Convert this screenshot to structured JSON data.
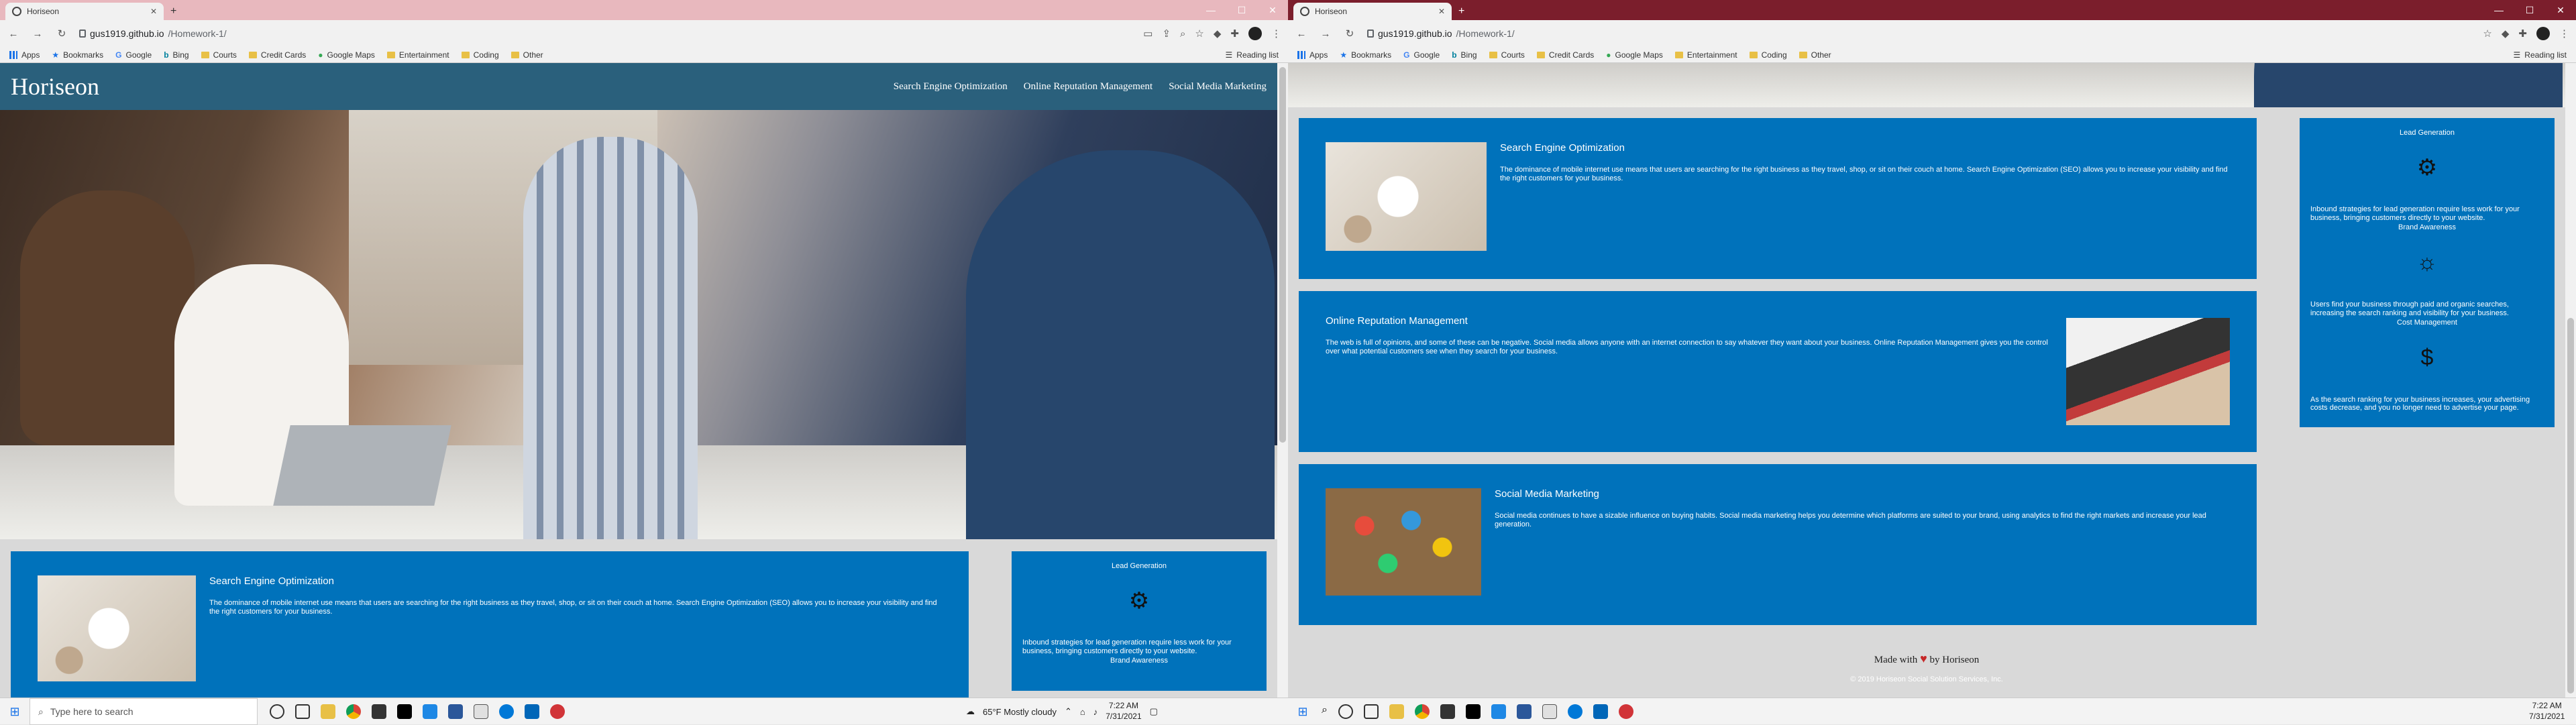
{
  "browser": {
    "tab_title": "Horiseon",
    "address_host": "gus1919.github.io",
    "address_path": "/Homework-1/",
    "bookmarks": [
      "Apps",
      "Bookmarks",
      "Google",
      "Bing",
      "Courts",
      "Credit Cards",
      "Google Maps",
      "Entertainment",
      "Coding",
      "Other"
    ],
    "reading_list": "Reading list"
  },
  "site": {
    "logo": "Horiseon",
    "nav": [
      "Search Engine Optimization",
      "Online Reputation Management",
      "Social Media Marketing"
    ],
    "cards": [
      {
        "title": "Search Engine Optimization",
        "text": "The dominance of mobile internet use means that users are searching for the right business as they travel, shop, or sit on their couch at home. Search Engine Optimization (SEO) allows you to increase your visibility and find the right customers for your business.",
        "image": "seo-image"
      },
      {
        "title": "Online Reputation Management",
        "text": "The web is full of opinions, and some of these can be negative. Social media allows anyone with an internet connection to say whatever they want about your business. Online Reputation Management gives you the control over what potential customers see when they search for your business.",
        "image": "orm-image"
      },
      {
        "title": "Social Media Marketing",
        "text": "Social media continues to have a sizable influence on buying habits. Social media marketing helps you determine which platforms are suited to your brand, using analytics to find the right markets and increase your lead generation.",
        "image": "smm-image"
      }
    ],
    "aside": [
      {
        "title": "Lead Generation",
        "icon": "lightbulb-gear-icon",
        "text": "Inbound strategies for lead generation require less work for your business, bringing customers directly to your website.",
        "next": "Brand Awareness"
      },
      {
        "icon": "lightbulb-brain-icon",
        "text": "Users find your business through paid and organic searches, increasing the search ranking and visibility for your business.",
        "next": "Cost Management"
      },
      {
        "icon": "gears-dollar-icon",
        "text": "As the search ranking for your business increases, your advertising costs decrease, and you no longer need to advertise your page."
      }
    ],
    "footer": {
      "made_prefix": "Made with",
      "made_suffix": "by Horiseon",
      "copyright": "© 2019 Horiseon Social Solution Services, Inc."
    }
  },
  "taskbar": {
    "search_placeholder": "Type here to search",
    "weather": "65°F  Mostly cloudy",
    "time": "7:22 AM",
    "date": "7/31/2021"
  },
  "colors": {
    "header": "#2a607c",
    "card": "#0072bb"
  }
}
